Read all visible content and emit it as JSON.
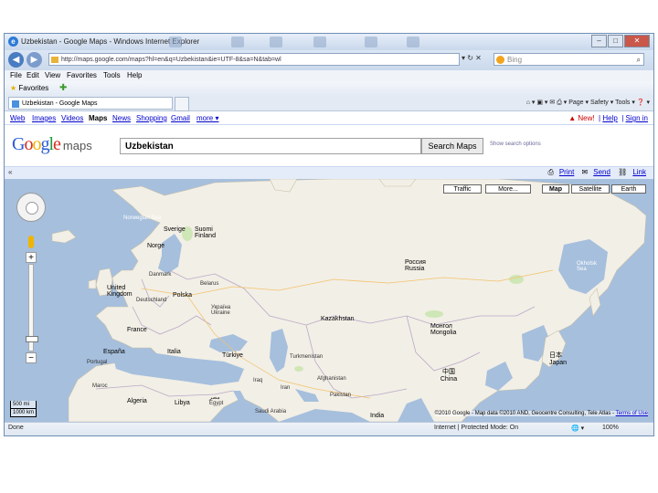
{
  "window": {
    "title": "Uzbekistan - Google Maps - Windows Internet Explorer",
    "controls": {
      "minimize": "–",
      "maximize": "□",
      "close": "✕"
    }
  },
  "address_bar": {
    "url": "http://maps.google.com/maps?hl=en&q=Uzbekistan&ie=UTF-8&sa=N&tab=wl",
    "controls": "▾ ↻ ✕",
    "search_placeholder": "Bing"
  },
  "menu": [
    "File",
    "Edit",
    "View",
    "Favorites",
    "Tools",
    "Help"
  ],
  "favorites": {
    "label": "Favorites"
  },
  "tab": {
    "label": "Uzbekistan - Google Maps"
  },
  "command_bar": "⌂ ▾  ▣ ▾  ✉  ⎙ ▾  Page ▾  Safety ▾  Tools ▾  ❓ ▾",
  "google_nav": {
    "links": [
      "Web",
      "Images",
      "Videos",
      "Maps",
      "News",
      "Shopping",
      "Gmail",
      "more ▾"
    ],
    "current": "Maps",
    "new_label": "New!",
    "help_label": "Help",
    "signin_label": "Sign in"
  },
  "search": {
    "logo_word": "Google",
    "logo_suffix": "maps",
    "query": "Uzbekistan",
    "button": "Search Maps",
    "options_link": "Show search options"
  },
  "map_toolbar": {
    "collapse": "«",
    "print": "Print",
    "send": "Send",
    "link": "Link"
  },
  "map": {
    "buttons": [
      "Traffic",
      "More...",
      "Map",
      "Satellite",
      "Earth"
    ],
    "zoom_plus": "+",
    "zoom_minus": "−",
    "scale": [
      "500 mi",
      "1000 km"
    ],
    "copyright": "©2010 Google - Map data ©2010 AND, Geocentre Consulting, Tele Atlas - ",
    "terms": "Terms of Use",
    "labels": [
      {
        "text": "Norwegian Sea"
      },
      {
        "text": "Sverige"
      },
      {
        "text": "Suomi Finland"
      },
      {
        "text": "Norge"
      },
      {
        "text": "Danmark"
      },
      {
        "text": "United Kingdom"
      },
      {
        "text": "Deutschland"
      },
      {
        "text": "Polska"
      },
      {
        "text": "Belarus"
      },
      {
        "text": "Україна Ukraine"
      },
      {
        "text": "France"
      },
      {
        "text": "España"
      },
      {
        "text": "Portugal"
      },
      {
        "text": "Italia"
      },
      {
        "text": "Türkiye"
      },
      {
        "text": "Maroc"
      },
      {
        "text": "Algeria"
      },
      {
        "text": "Libya"
      },
      {
        "text": "مصر Egypt"
      },
      {
        "text": "Saudi Arabia"
      },
      {
        "text": "Россия Russia"
      },
      {
        "text": "Kazakhstan"
      },
      {
        "text": "Монгол Mongolia"
      },
      {
        "text": "Turkmenistan"
      },
      {
        "text": "Afghanistan"
      },
      {
        "text": "Pakistan"
      },
      {
        "text": "India"
      },
      {
        "text": "中国 China"
      },
      {
        "text": "日本 Japan"
      },
      {
        "text": "Okhotsk Sea"
      },
      {
        "text": "Iran"
      },
      {
        "text": "Iraq"
      }
    ]
  },
  "status_bar": {
    "left": "Done",
    "zone": "Internet | Protected Mode: On",
    "zoom": "100%"
  }
}
